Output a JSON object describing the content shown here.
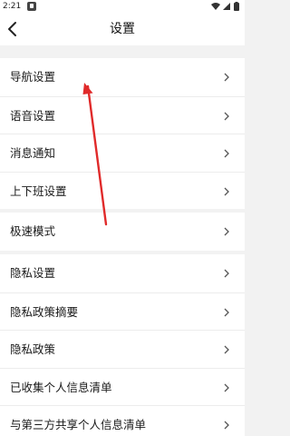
{
  "status_bar": {
    "time": "2:21"
  },
  "header": {
    "title": "设置"
  },
  "groups": [
    {
      "items": [
        {
          "label": "导航设置"
        },
        {
          "label": "语音设置"
        },
        {
          "label": "消息通知"
        },
        {
          "label": "上下班设置"
        }
      ]
    },
    {
      "items": [
        {
          "label": "极速模式"
        }
      ]
    },
    {
      "items": [
        {
          "label": "隐私设置"
        },
        {
          "label": "隐私政策摘要"
        },
        {
          "label": "隐私政策"
        },
        {
          "label": "已收集个人信息清单"
        },
        {
          "label": "与第三方共享个人信息清单"
        }
      ]
    }
  ],
  "colors": {
    "annotation_arrow": "#e02a2a",
    "background": "#f2f2f2",
    "surface": "#ffffff"
  }
}
